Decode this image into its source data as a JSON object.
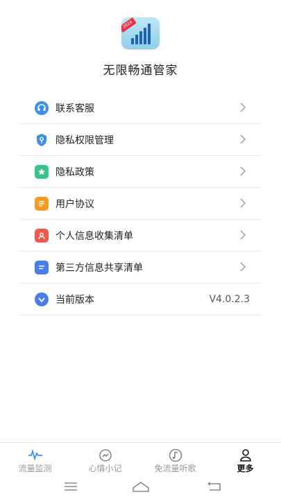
{
  "app": {
    "name": "无限畅通管家",
    "icon_name": "app-logo-icon",
    "badge": "2024"
  },
  "menu": [
    {
      "id": "contact",
      "label": "联系客服",
      "icon": "headset-icon",
      "color": "#3f8ee8"
    },
    {
      "id": "permissions",
      "label": "隐私权限管理",
      "icon": "shield-key-icon",
      "color": "#3f8ee8"
    },
    {
      "id": "policy",
      "label": "隐私政策",
      "icon": "star-bookmark-icon",
      "color": "#36c48a"
    },
    {
      "id": "agreement",
      "label": "用户协议",
      "icon": "document-icon",
      "color": "#f59a23"
    },
    {
      "id": "personal-info",
      "label": "个人信息收集清单",
      "icon": "user-card-icon",
      "color": "#ef5b4f"
    },
    {
      "id": "third-party",
      "label": "第三方信息共享清单",
      "icon": "list-doc-icon",
      "color": "#4a7de8"
    },
    {
      "id": "version",
      "label": "当前版本",
      "icon": "version-check-icon",
      "color": "#4a7de8",
      "value": "V4.0.2.3"
    }
  ],
  "tabs": [
    {
      "label": "流量监测",
      "icon": "pulse-icon",
      "active": false
    },
    {
      "label": "心情小记",
      "icon": "mood-icon",
      "active": false
    },
    {
      "label": "免流量听歌",
      "icon": "music-icon",
      "active": false
    },
    {
      "label": "更多",
      "icon": "person-icon",
      "active": true
    }
  ],
  "nav": {
    "menu_icon": "menu-lines-icon",
    "home_icon": "home-icon",
    "back_icon": "back-icon"
  }
}
